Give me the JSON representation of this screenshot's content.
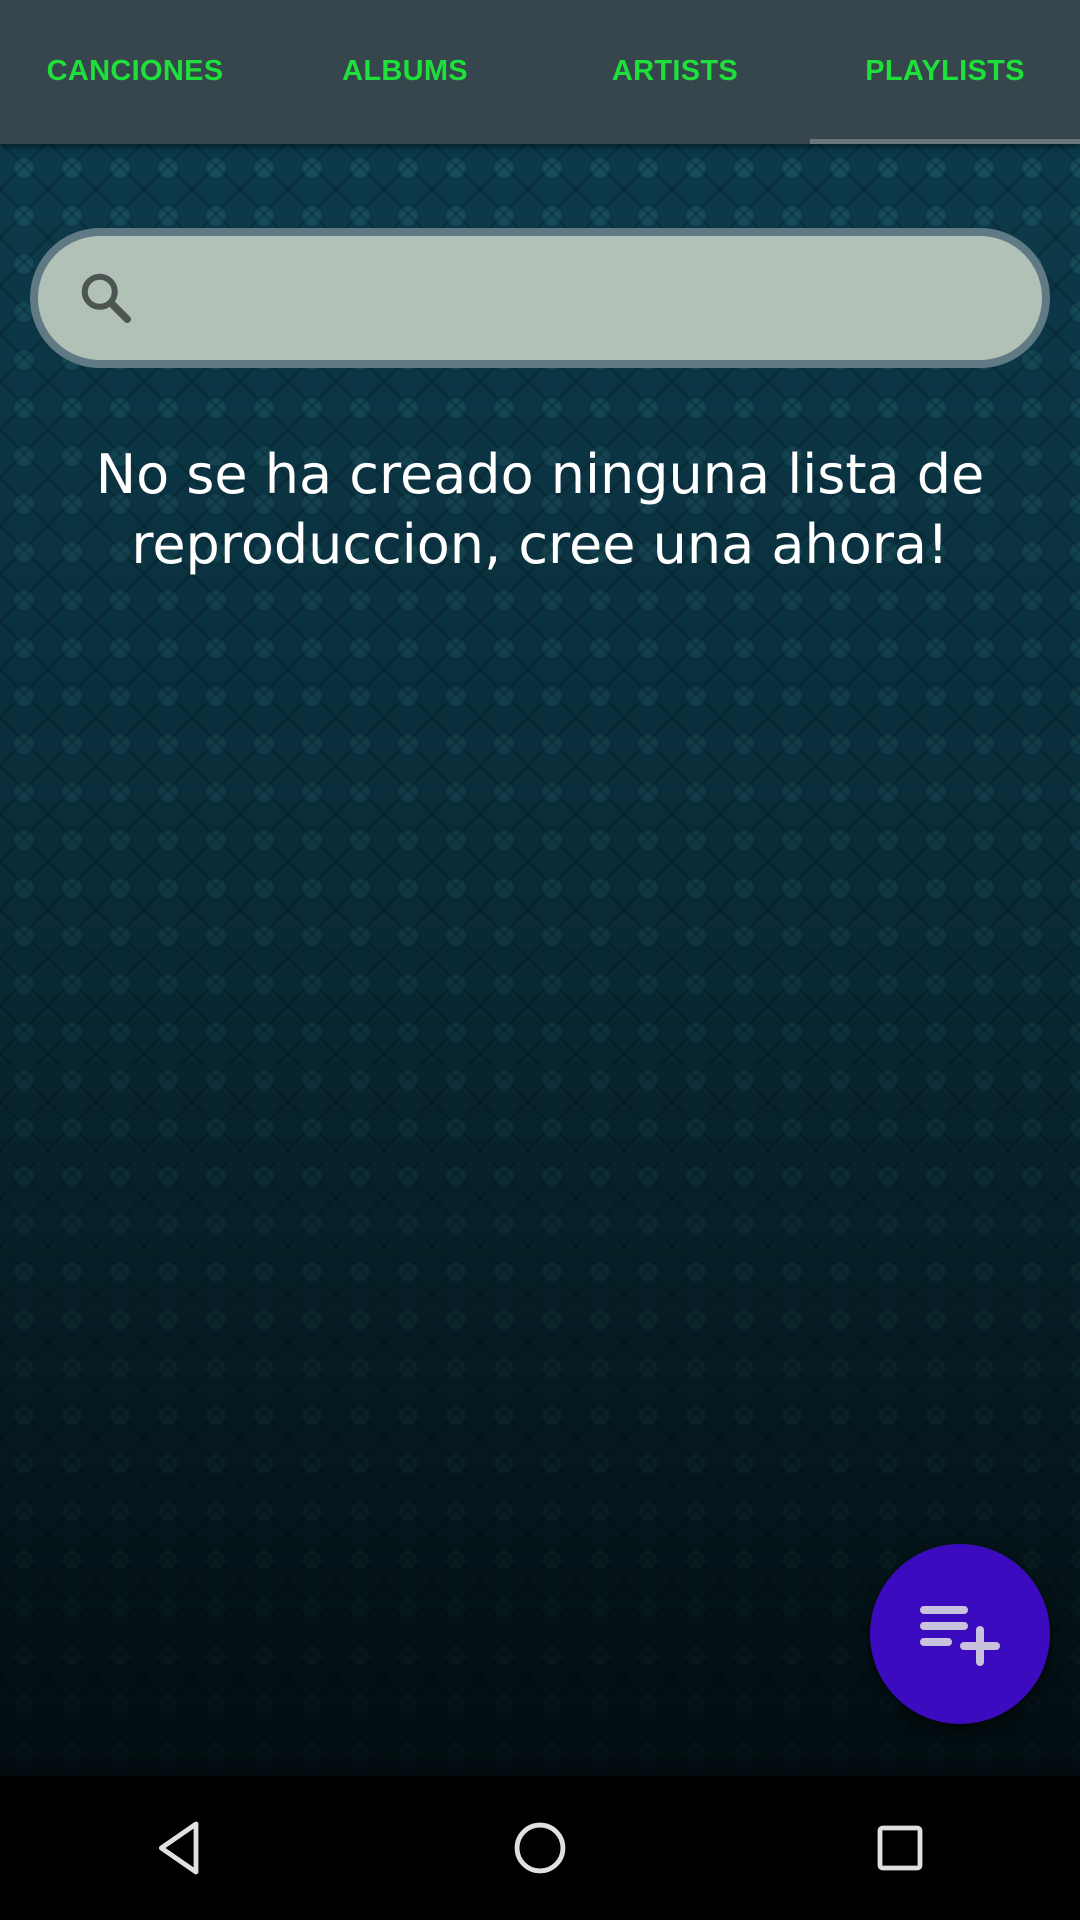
{
  "tabs": [
    {
      "label": "CANCIONES",
      "active": false
    },
    {
      "label": "ALBUMS",
      "active": false
    },
    {
      "label": "ARTISTS",
      "active": false
    },
    {
      "label": "PLAYLISTS",
      "active": true
    }
  ],
  "search": {
    "value": "",
    "placeholder": "",
    "icon": "search-icon"
  },
  "empty_message": "No se ha creado ninguna lista de reproduccion, cree una ahora!",
  "fab": {
    "icon": "playlist-add-icon"
  },
  "navbar": {
    "icons": [
      "back-icon",
      "home-icon",
      "recents-icon"
    ]
  },
  "colors": {
    "tab_text": "#1ee03a",
    "tab_bar": "#37454d",
    "search_fill": "#b2c1b5",
    "fab": "#3d0bbf"
  }
}
